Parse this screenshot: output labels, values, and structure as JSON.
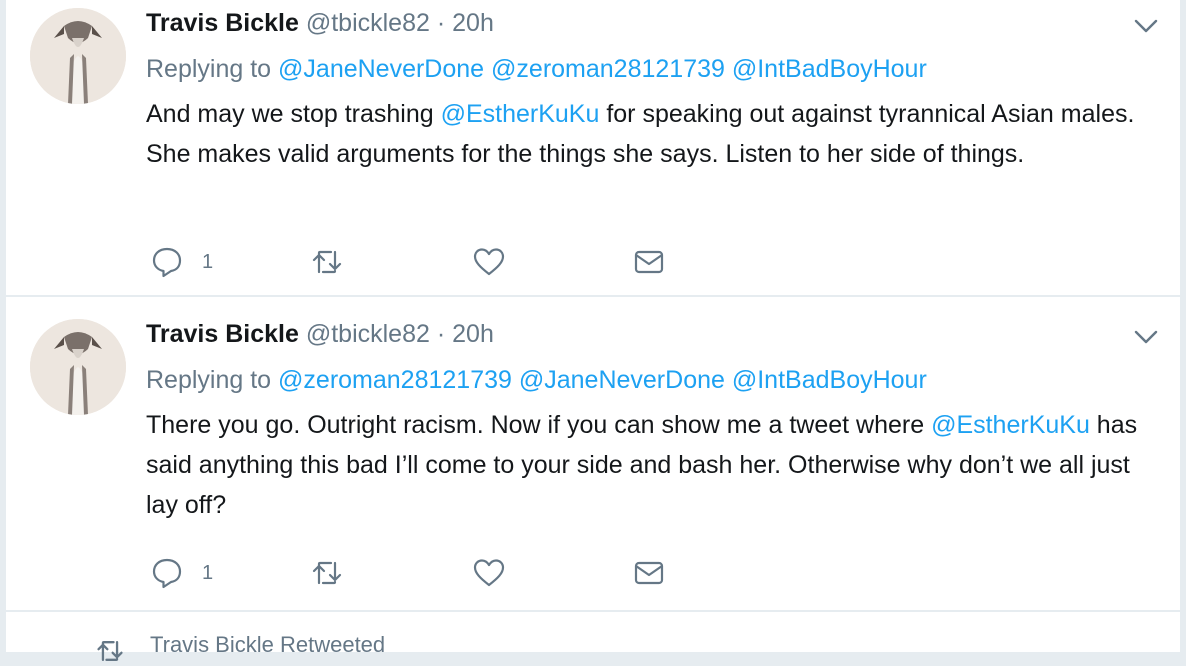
{
  "tweets": [
    {
      "name": "Travis Bickle",
      "handle": "@tbickle82",
      "dot": "·",
      "time": "20h",
      "replying_prefix": "Replying to",
      "replying_to": [
        "@JaneNeverDone",
        "@zeroman28121739",
        "@IntBadBoyHour"
      ],
      "text_before": "And may we stop trashing ",
      "text_mention": "@EstherKuKu",
      "text_after": " for speaking out against tyrannical Asian males. She makes valid arguments for the things she says. Listen to her side of things.",
      "reply_count": "1"
    },
    {
      "name": "Travis Bickle",
      "handle": "@tbickle82",
      "dot": "·",
      "time": "20h",
      "replying_prefix": "Replying to",
      "replying_to": [
        "@zeroman28121739",
        "@JaneNeverDone",
        "@IntBadBoyHour"
      ],
      "text_before": "There you go. Outright racism. Now if you can show me a tweet where ",
      "text_mention": "@EstherKuKu",
      "text_after": " has said anything this bad I’ll come to your side and bash her. Otherwise why don’t we all just lay off?",
      "reply_count": "1"
    }
  ],
  "retweet_context": "Travis Bickle Retweeted",
  "colors": {
    "link": "#1da1f2",
    "muted": "#657786",
    "text": "#14171a",
    "background": "#e6ecf0"
  },
  "icons": [
    "avatar-dog-image",
    "chevron-down-icon",
    "reply-icon",
    "retweet-icon",
    "heart-icon",
    "envelope-icon"
  ]
}
